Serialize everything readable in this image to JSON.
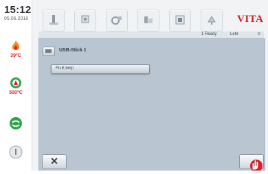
{
  "status": {
    "time": "15:12",
    "date": "05.06.2018",
    "temp_1": "39°C",
    "temp_2": "500°C"
  },
  "brand": "VITA",
  "toolbar_icons": [
    "tool-icon-1",
    "tool-icon-2",
    "tool-icon-3",
    "tool-icon-4",
    "tool-icon-5",
    "tool-icon-6"
  ],
  "panel": {
    "ready_label": "1 Ready",
    "lehr_label": "Lehr",
    "usb_label": "USB-Stick 1",
    "file_label": "FILE.bmp"
  },
  "buttons": {
    "cancel": "✕"
  },
  "colors": {
    "brand": "#d21d27",
    "panel": "#b9c6d2",
    "accent_red": "#e21c2a",
    "accent_green": "#2fa24a"
  }
}
